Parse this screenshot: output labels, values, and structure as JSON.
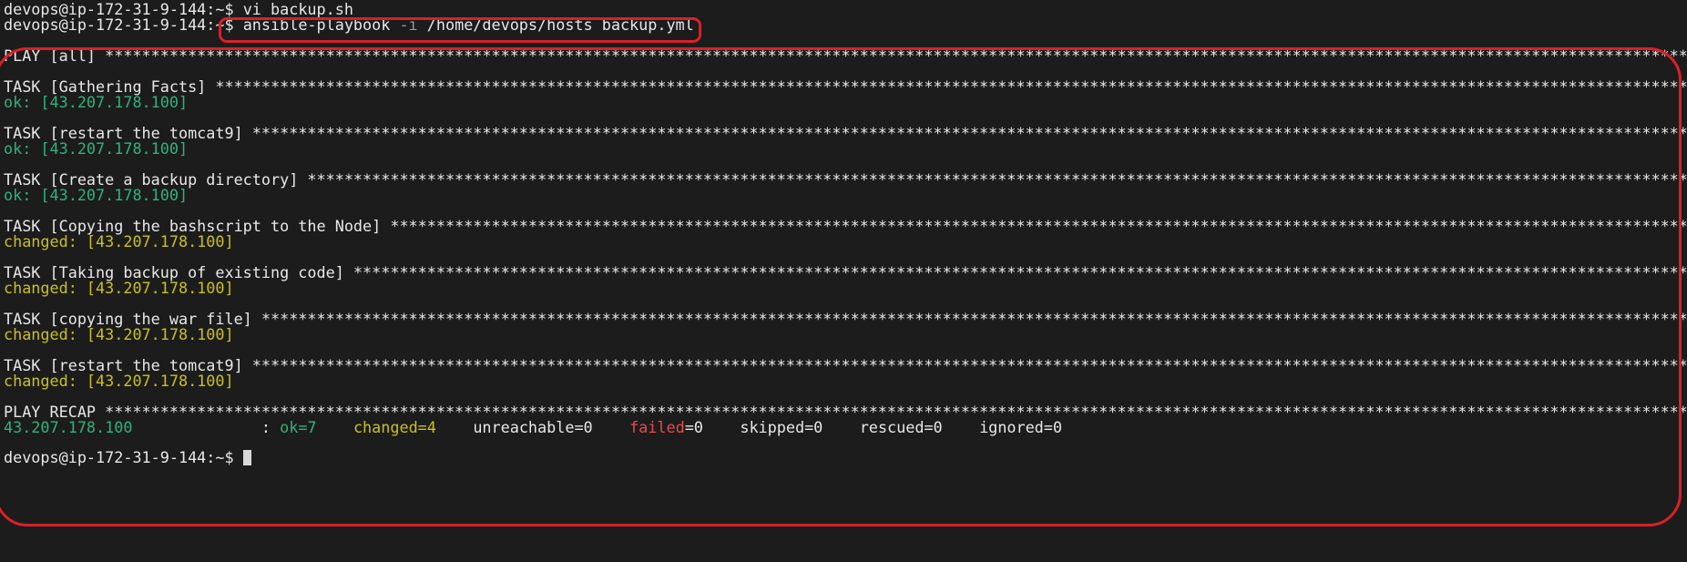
{
  "terminal": {
    "prompt": "devops@ip-172-31-9-144:~$",
    "line1_cmd": " vi backup.sh",
    "line2_cmd_prefix": " ansible-playbook ",
    "line2_flag": "-i",
    "line2_cmd_suffix": " /home/devops/hosts backup.yml",
    "play_header": "PLAY [all] ",
    "tasks": [
      {
        "header": "TASK [Gathering Facts] ",
        "status": "ok: [43.207.178.100]"
      },
      {
        "header": "TASK [restart the tomcat9] ",
        "status": "ok: [43.207.178.100]"
      },
      {
        "header": "TASK [Create a backup directory] ",
        "status": "ok: [43.207.178.100]"
      },
      {
        "header": "TASK [Copying the bashscript to the Node] ",
        "status": "changed: [43.207.178.100]"
      },
      {
        "header": "TASK [Taking backup of existing code] ",
        "status": "changed: [43.207.178.100]"
      },
      {
        "header": "TASK [copying the war file] ",
        "status": "changed: [43.207.178.100]"
      },
      {
        "header": "TASK [restart the tomcat9] ",
        "status": "changed: [43.207.178.100]"
      }
    ],
    "recap_header": "PLAY RECAP ",
    "recap": {
      "host": "43.207.178.100",
      "sep": "              : ",
      "ok": "ok=7",
      "changed": "changed=4",
      "unreachable": "unreachable=0",
      "failed_label": "failed",
      "failed_value": "=0",
      "skipped": "skipped=0",
      "rescued": "rescued=0",
      "ignored": "ignored=0"
    },
    "final_prompt": "devops@ip-172-31-9-144:~$ ",
    "stars": "**************************************************************************************************************************************************************************************************************",
    "colors": {
      "background": "#1c1c1c",
      "text": "#e8e8e8",
      "ok": "#2fb37a",
      "changed": "#c9c020",
      "failed": "#e84b4b",
      "highlight": "#d9202a"
    }
  }
}
